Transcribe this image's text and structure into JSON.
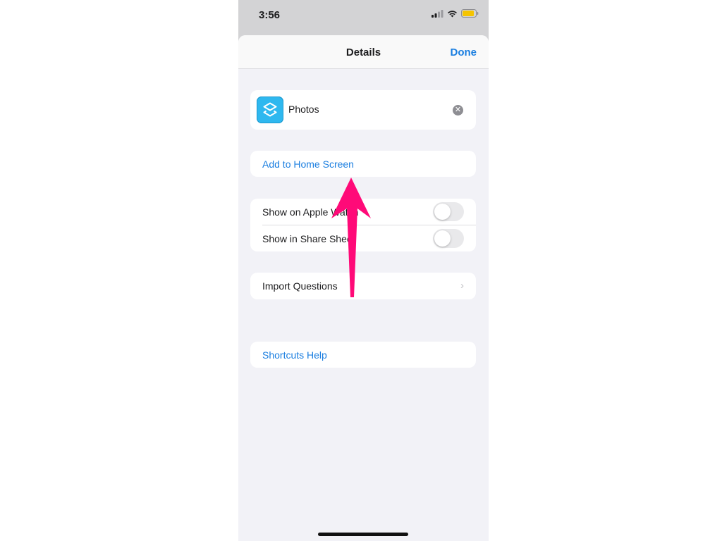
{
  "status_bar": {
    "time": "3:56",
    "icons": [
      "cellular-signal-icon",
      "wifi-icon",
      "battery-icon"
    ],
    "battery_color": "#f5c400"
  },
  "nav": {
    "title": "Details",
    "done_label": "Done"
  },
  "shortcut": {
    "name": "Photos",
    "icon": "shortcuts-icon",
    "icon_color": "#2fb8ef",
    "clear_icon": "clear-icon"
  },
  "actions": {
    "add_to_home_screen": "Add to Home Screen",
    "import_questions": "Import Questions",
    "shortcuts_help": "Shortcuts Help"
  },
  "toggles": [
    {
      "label": "Show on Apple Watch",
      "on": false
    },
    {
      "label": "Show in Share Sheet",
      "on": false
    }
  ],
  "annotation": {
    "icon": "arrow-up-icon",
    "color": "#ff0a78"
  },
  "theme": {
    "accent": "#1a7ee0",
    "background": "#f2f2f7"
  }
}
